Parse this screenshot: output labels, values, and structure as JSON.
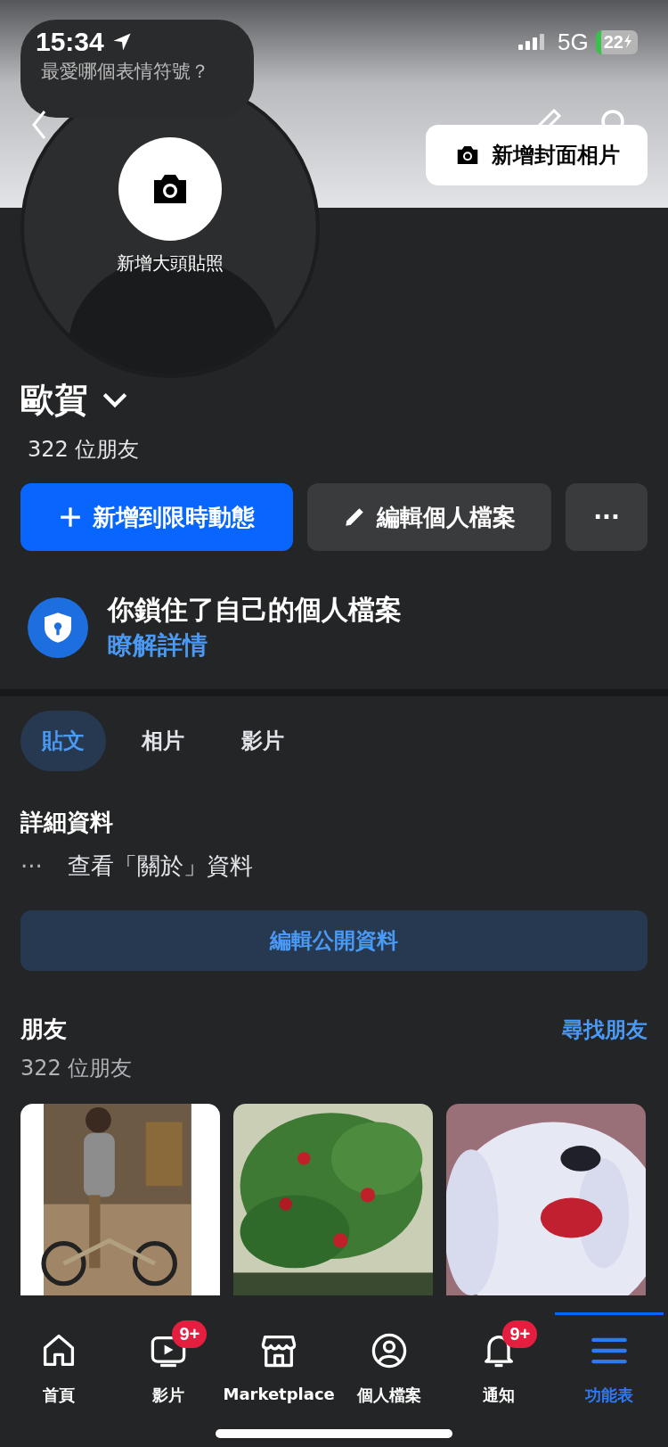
{
  "status_bar": {
    "time": "15:34",
    "network": "5G",
    "battery": "22"
  },
  "tooltip": {
    "text": "最愛哪個表情符號？"
  },
  "cover": {
    "button": "新增封面相片"
  },
  "avatar": {
    "label": "新增大頭貼照"
  },
  "profile": {
    "name": "歐賀",
    "friends_count": "322 位朋友"
  },
  "actions": [
    {
      "kind": "primary",
      "label": "新增到限時動態"
    },
    {
      "kind": "edit",
      "label": "編輯個人檔案"
    },
    {
      "kind": "more",
      "label": "···"
    }
  ],
  "lock_notice": {
    "title": "你鎖住了自己的個人檔案",
    "link": "瞭解詳情"
  },
  "tabs": [
    {
      "label": "貼文",
      "selected": true
    },
    {
      "label": "相片",
      "selected": false
    },
    {
      "label": "影片",
      "selected": false
    }
  ],
  "details": {
    "heading": "詳細資料",
    "about_icon": "···",
    "about": "查看「關於」資料",
    "edit_button": "編輯公開資料"
  },
  "friends": {
    "heading": "朋友",
    "find_link": "尋找朋友",
    "count": "322 位朋友"
  },
  "nav": [
    {
      "kind": "home",
      "label": "首頁",
      "selected": false
    },
    {
      "kind": "video",
      "label": "影片",
      "badge": "9+",
      "selected": false
    },
    {
      "kind": "store",
      "label": "Marketplace",
      "selected": false
    },
    {
      "kind": "profile",
      "label": "個人檔案",
      "selected": false
    },
    {
      "kind": "bell",
      "label": "通知",
      "badge": "9+",
      "selected": false
    },
    {
      "kind": "menu",
      "label": "功能表",
      "selected": true
    }
  ]
}
